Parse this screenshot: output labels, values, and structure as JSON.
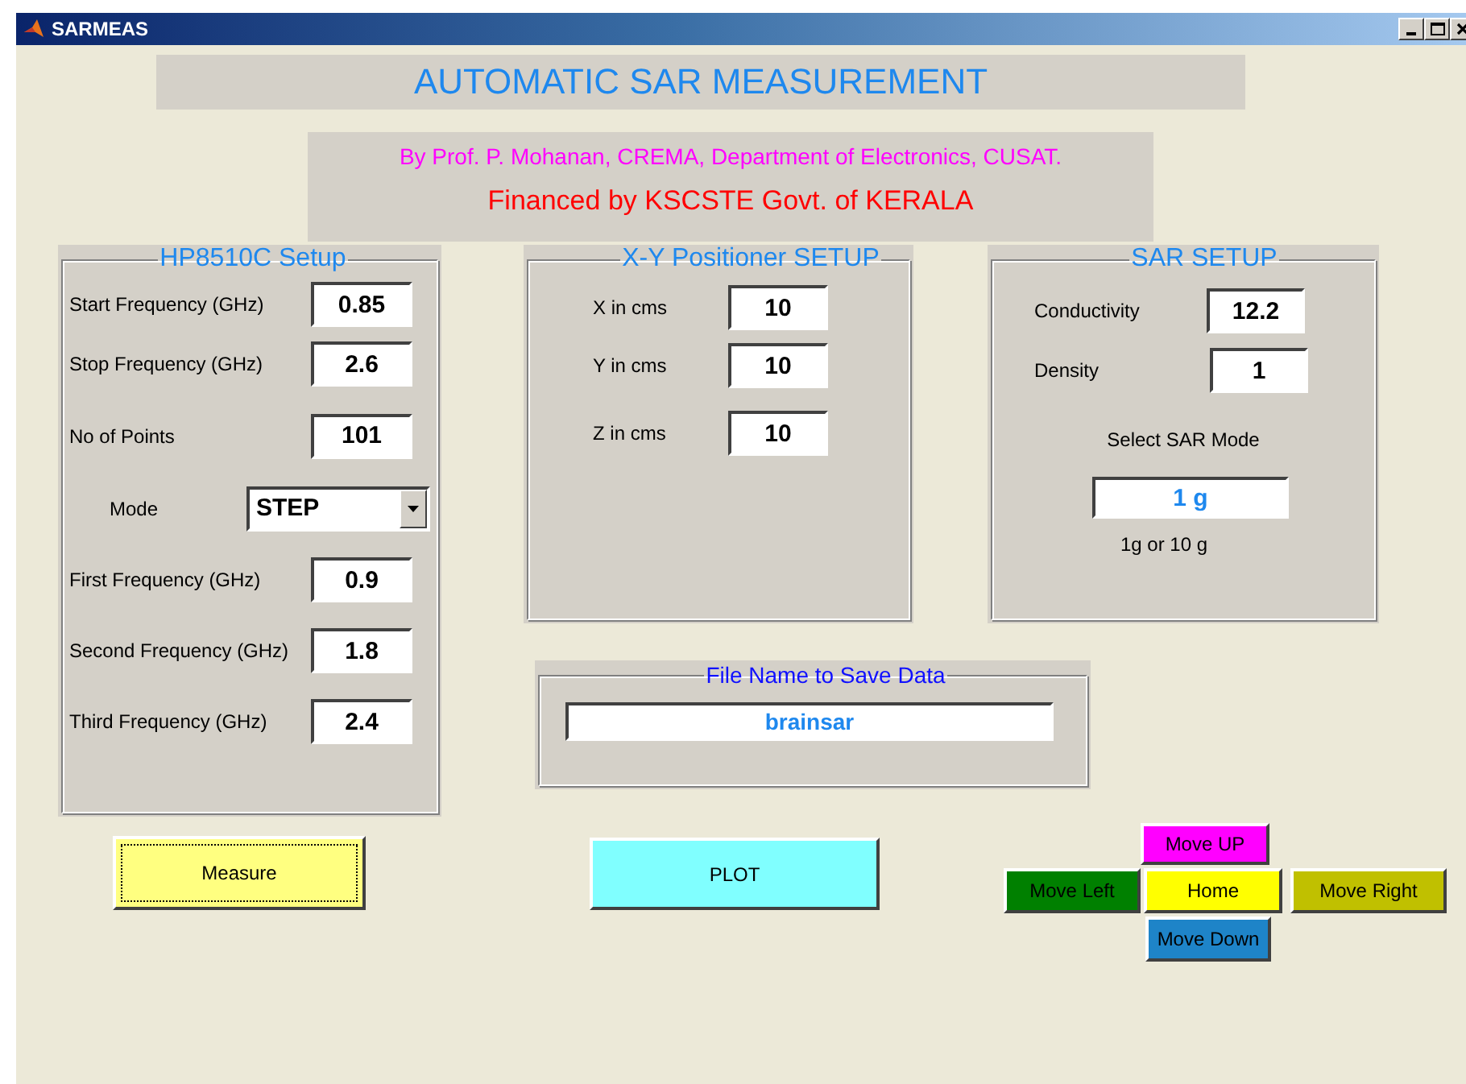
{
  "window": {
    "title": "SARMEAS"
  },
  "heading": "AUTOMATIC SAR MEASUREMENT",
  "credits": [
    {
      "text": "By Prof. P. Mohanan, CREMA, Department of Electronics, CUSAT.",
      "kind": "author"
    },
    {
      "text": "Financed by KSCSTE Govt. of  KERALA",
      "kind": "funding"
    }
  ],
  "hp_setup": {
    "title": "HP8510C Setup",
    "rows": [
      {
        "kind": "field",
        "label": "Start Frequency (GHz)",
        "value": "0.85"
      },
      {
        "kind": "field",
        "label": "Stop Frequency (GHz)",
        "value": "2.6"
      },
      {
        "kind": "field",
        "label": "No of Points",
        "value": "101"
      },
      {
        "kind": "dropdown",
        "label": "Mode",
        "value": "STEP"
      },
      {
        "kind": "field",
        "label": "First Frequency (GHz)",
        "value": "0.9"
      },
      {
        "kind": "field",
        "label": "Second Frequency (GHz)",
        "value": "1.8"
      },
      {
        "kind": "field",
        "label": "Third Frequency (GHz)",
        "value": "2.4"
      }
    ]
  },
  "xy_setup": {
    "title": "X-Y Positioner SETUP",
    "rows": [
      {
        "label": "X in cms",
        "value": "10"
      },
      {
        "label": "Y in cms",
        "value": "10"
      },
      {
        "label": "Z in cms",
        "value": "10"
      }
    ]
  },
  "sar_setup": {
    "title": "SAR SETUP",
    "rows": [
      {
        "label": "Conductivity",
        "value": "12.2"
      },
      {
        "label": "Density",
        "value": "1"
      }
    ],
    "mode_label": "Select SAR Mode",
    "mode_value": "1 g",
    "mode_hint": "1g or 10 g"
  },
  "file_panel": {
    "title": "File Name to Save Data",
    "value": "brainsar"
  },
  "buttons": [
    {
      "label": "Measure",
      "color": "#ffff80",
      "focused": true
    },
    {
      "label": "PLOT",
      "color": "#80ffff",
      "focused": false
    }
  ],
  "nav_buttons": [
    {
      "label": "Move UP",
      "color": "#ff00ff",
      "kind": "up"
    },
    {
      "label": "Move Left",
      "color": "#008000",
      "kind": "left"
    },
    {
      "label": "Home",
      "color": "#ffff00",
      "kind": "home"
    },
    {
      "label": "Move Right",
      "color": "#c0c000",
      "kind": "right"
    },
    {
      "label": "Move Down",
      "color": "#1e84c8",
      "kind": "down"
    }
  ]
}
